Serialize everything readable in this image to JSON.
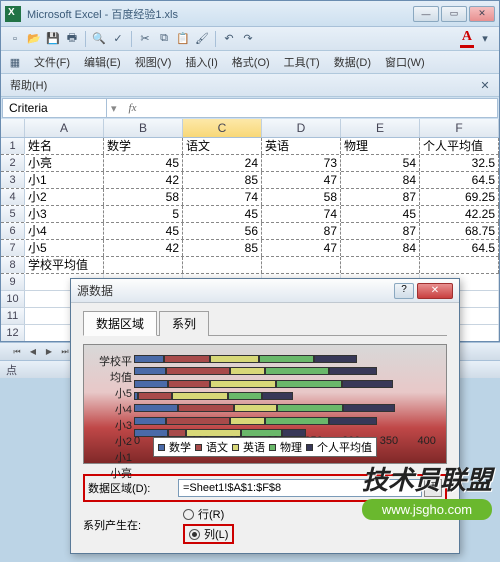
{
  "app": {
    "title": "Microsoft Excel - 百度经验1.xls"
  },
  "menubar": {
    "file": "文件(F)",
    "edit": "编辑(E)",
    "view": "视图(V)",
    "insert": "插入(I)",
    "format": "格式(O)",
    "tools": "工具(T)",
    "data": "数据(D)",
    "window": "窗口(W)",
    "help": "帮助(H)"
  },
  "namebox": "Criteria",
  "fx_label": "fx",
  "columns": [
    "A",
    "B",
    "C",
    "D",
    "E",
    "F"
  ],
  "headers": [
    "姓名",
    "数学",
    "语文",
    "英语",
    "物理",
    "个人平均值"
  ],
  "data_rows": [
    {
      "name": "小亮",
      "vals": [
        45,
        24,
        73,
        54,
        "32.5"
      ]
    },
    {
      "name": "小1",
      "vals": [
        42,
        85,
        47,
        84,
        "64.5"
      ]
    },
    {
      "name": "小2",
      "vals": [
        58,
        74,
        58,
        87,
        "69.25"
      ]
    },
    {
      "name": "小3",
      "vals": [
        5,
        45,
        74,
        45,
        "42.25"
      ]
    },
    {
      "name": "小4",
      "vals": [
        45,
        56,
        87,
        87,
        "68.75"
      ]
    },
    {
      "name": "小5",
      "vals": [
        42,
        85,
        47,
        84,
        "64.5"
      ]
    }
  ],
  "summary_row": "学校平均值",
  "status_text": "点",
  "dialog": {
    "title": "源数据",
    "tabs": {
      "range": "数据区域",
      "series": "系列"
    },
    "range_label": "数据区域(D):",
    "range_value": "=Sheet1!$A$1:$F$8",
    "series_label": "系列产生在:",
    "opt_row": "行(R)",
    "opt_col": "列(L)"
  },
  "chart_data": {
    "type": "bar",
    "categories": [
      "小亮",
      "小1",
      "小2",
      "小3",
      "小4",
      "小5",
      "学校平均值"
    ],
    "series": [
      {
        "name": "数学",
        "values": [
          45,
          42,
          58,
          5,
          45,
          42,
          39.5
        ],
        "color": "#4a6aa8"
      },
      {
        "name": "语文",
        "values": [
          24,
          85,
          74,
          45,
          56,
          85,
          61.5
        ],
        "color": "#a84a4a"
      },
      {
        "name": "英语",
        "values": [
          73,
          47,
          58,
          74,
          87,
          47,
          64.3
        ],
        "color": "#d8d878"
      },
      {
        "name": "物理",
        "values": [
          54,
          84,
          87,
          45,
          87,
          84,
          73.5
        ],
        "color": "#6ab86a"
      },
      {
        "name": "个人平均值",
        "values": [
          32.5,
          64.5,
          69.25,
          42.25,
          68.75,
          64.5,
          57.0
        ],
        "color": "#383858"
      }
    ],
    "xlabel": "",
    "ylabel": "",
    "xlim": [
      0,
      400
    ],
    "xticks": [
      0,
      50,
      100,
      150,
      200,
      250,
      300,
      350,
      400
    ]
  },
  "watermark": {
    "text": "技术员联盟",
    "url": "www.jsgho.com"
  }
}
